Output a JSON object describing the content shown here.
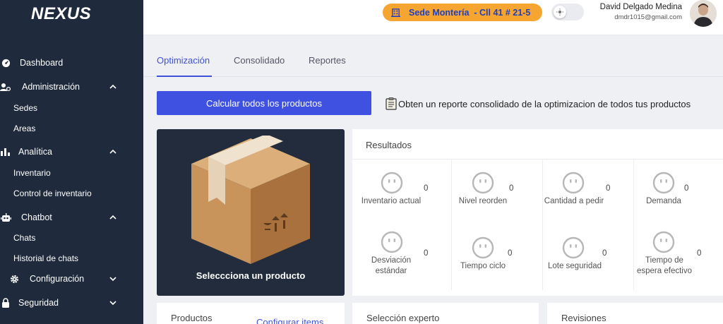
{
  "app": {
    "logo": "NEXUS"
  },
  "sidebar": {
    "items": [
      {
        "label": "Dashboard",
        "icon": "dashboard-icon"
      },
      {
        "label": "Administración",
        "icon": "users-icon"
      },
      {
        "label": "Analítica",
        "icon": "bar-chart-icon"
      },
      {
        "label": "Chatbot",
        "icon": "robot-icon"
      },
      {
        "label": "Configuración",
        "icon": "gear-icon"
      },
      {
        "label": "Seguridad",
        "icon": "lock-icon"
      }
    ],
    "admin_sub": [
      "Sedes",
      "Areas"
    ],
    "analytics_sub": [
      "Inventario",
      "Control de inventario"
    ],
    "chatbot_sub": [
      "Chats",
      "Historial de chats"
    ]
  },
  "topbar": {
    "sede": "Sede Montería  - Cll 41 # 21-5",
    "user_name": "David Delgado Medina",
    "user_email": "dmdr1015@gmail.com"
  },
  "tabs": [
    "Optimización",
    "Consolidado",
    "Reportes"
  ],
  "actions": {
    "calc_label": "Calcular todos los productos",
    "report_hint": "Obten un reporte consolidado de la optimizacion de todos tus productos"
  },
  "product_card": {
    "caption": "Seleccciona un producto"
  },
  "results": {
    "title": "Resultados",
    "metrics": [
      {
        "label": "Inventario actual",
        "value": "0"
      },
      {
        "label": "Nivel reorden",
        "value": "0"
      },
      {
        "label": "Cantidad a pedir",
        "value": "0"
      },
      {
        "label": "Demanda",
        "value": "0"
      },
      {
        "label": "Desviación estándar",
        "value": "0"
      },
      {
        "label": "Tiempo ciclo",
        "value": "0"
      },
      {
        "label": "Lote seguridad",
        "value": "0"
      },
      {
        "label": "Tiempo de espera efectivo",
        "value": "0"
      }
    ]
  },
  "bottom": {
    "productos": "Productos",
    "configurar": "Configurar items",
    "seleccion": "Selección experto",
    "revisiones": "Revisiones"
  },
  "colors": {
    "sidebar": "#1f2a3c",
    "accent": "#3f51e0",
    "sede_pill": "#f5a530"
  }
}
